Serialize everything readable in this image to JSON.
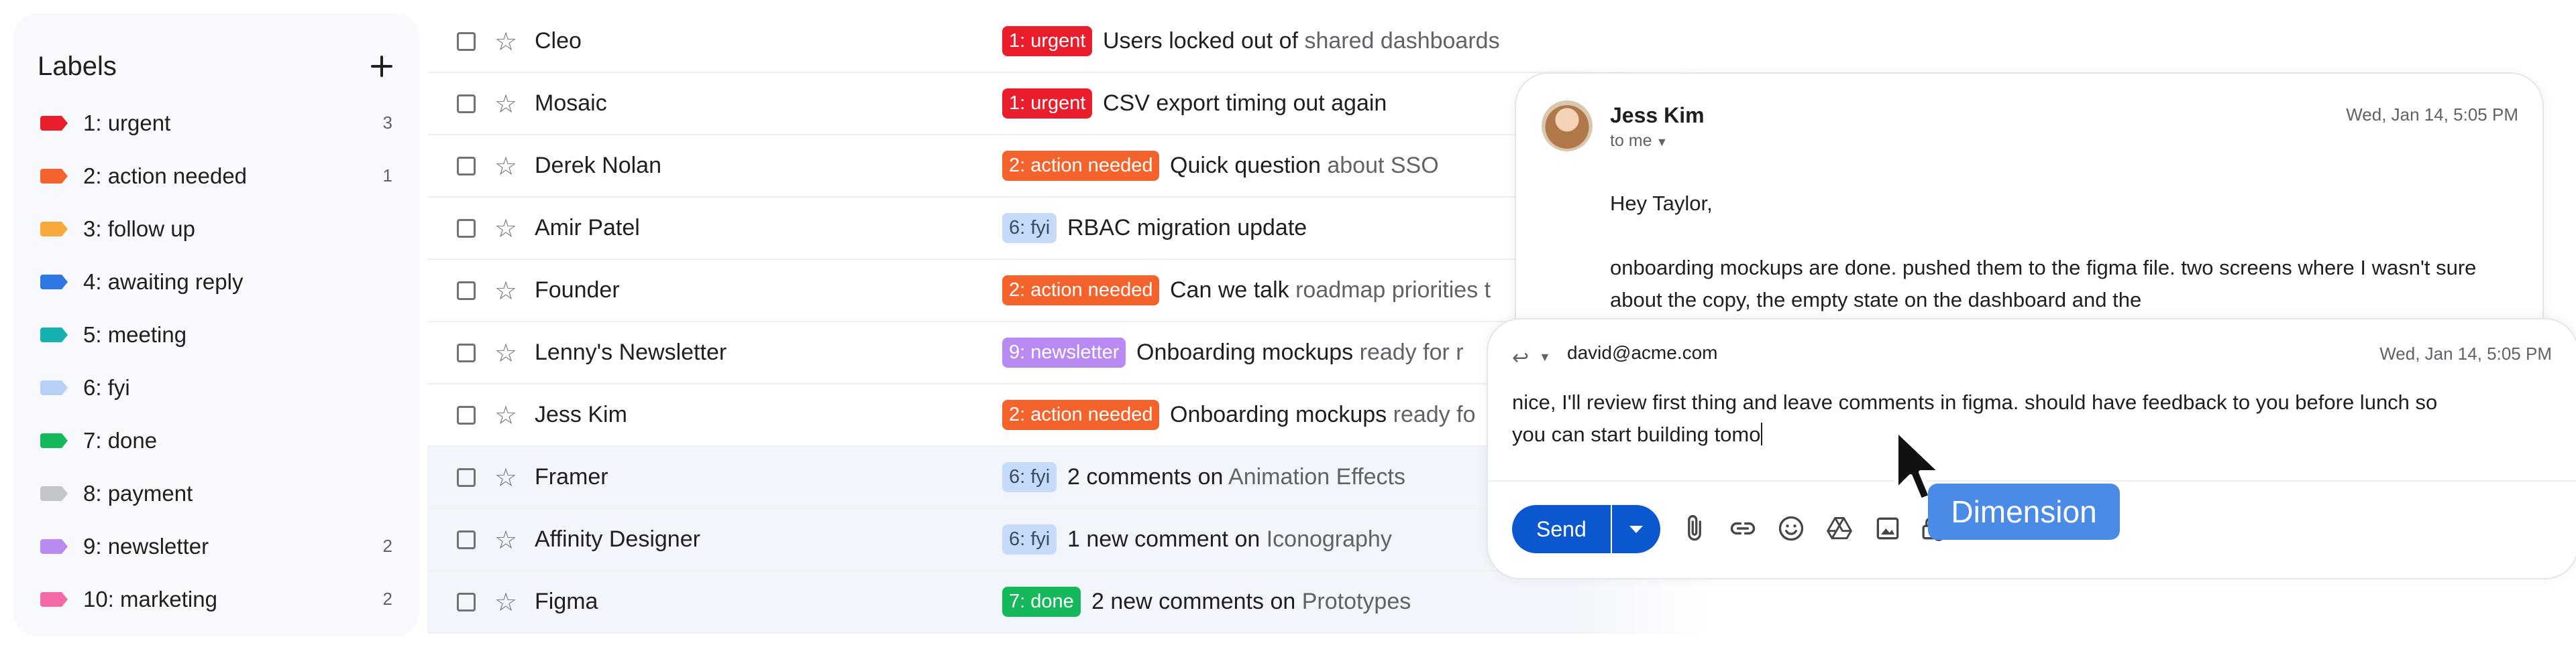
{
  "labels": {
    "title": "Labels",
    "items": [
      {
        "name": "1: urgent",
        "count": "3",
        "color": "#ea1d2c"
      },
      {
        "name": "2: action needed",
        "count": "1",
        "color": "#f4632b"
      },
      {
        "name": "3: follow up",
        "count": "",
        "color": "#f7a93b"
      },
      {
        "name": "4: awaiting reply",
        "count": "",
        "color": "#2f78e3"
      },
      {
        "name": "5: meeting",
        "count": "",
        "color": "#15b1b1"
      },
      {
        "name": "6: fyi",
        "count": "",
        "color": "#b7d0f7"
      },
      {
        "name": "7: done",
        "count": "",
        "color": "#16b85c"
      },
      {
        "name": "8: payment",
        "count": "",
        "color": "#c3c6ca"
      },
      {
        "name": "9: newsletter",
        "count": "2",
        "color": "#b98af2"
      },
      {
        "name": "10: marketing",
        "count": "2",
        "color": "#f46aa6"
      }
    ]
  },
  "messages": [
    {
      "sender": "Cleo",
      "label": "1: urgent",
      "label_bg": "#ea1d2c",
      "label_fg": "#ffffff",
      "subject": "Users locked out of",
      "snippet": " shared dashboards",
      "read": false
    },
    {
      "sender": "Mosaic",
      "label": "1: urgent",
      "label_bg": "#ea1d2c",
      "label_fg": "#ffffff",
      "subject": "CSV export timing out again",
      "snippet": "",
      "read": false
    },
    {
      "sender": "Derek Nolan",
      "label": "2: action needed",
      "label_bg": "#f4632b",
      "label_fg": "#ffffff",
      "subject": "Quick question",
      "snippet": " about SSO",
      "read": false
    },
    {
      "sender": "Amir Patel",
      "label": "6: fyi",
      "label_bg": "#c6dbfa",
      "label_fg": "#3b4a66",
      "subject": "RBAC migration update",
      "snippet": "",
      "read": false
    },
    {
      "sender": "Founder",
      "label": "2: action needed",
      "label_bg": "#f4632b",
      "label_fg": "#ffffff",
      "subject": "Can we talk",
      "snippet": " roadmap priorities t",
      "read": false
    },
    {
      "sender": "Lenny's Newsletter",
      "label": "9: newsletter",
      "label_bg": "#b98af2",
      "label_fg": "#ffffff",
      "subject": "Onboarding mockups",
      "snippet": " ready for r",
      "read": false
    },
    {
      "sender": "Jess Kim",
      "label": "2: action needed",
      "label_bg": "#f4632b",
      "label_fg": "#ffffff",
      "subject": "Onboarding mockups",
      "snippet": " ready fo",
      "read": false
    },
    {
      "sender": "Framer",
      "label": "6: fyi",
      "label_bg": "#c6dbfa",
      "label_fg": "#3b4a66",
      "subject": "2 comments on",
      "snippet": " Animation Effects",
      "read": true
    },
    {
      "sender": "Affinity Designer",
      "label": "6: fyi",
      "label_bg": "#c6dbfa",
      "label_fg": "#3b4a66",
      "subject": "1 new comment on",
      "snippet": " Iconography",
      "read": true
    },
    {
      "sender": "Figma",
      "label": "7: done",
      "label_bg": "#16b85c",
      "label_fg": "#ffffff",
      "subject": "2 new comments on",
      "snippet": " Prototypes",
      "read": true
    }
  ],
  "email": {
    "sender": "Jess Kim",
    "to": "to me",
    "date": "Wed, Jan 14, 5:05 PM",
    "greeting": "Hey Taylor,",
    "body": "onboarding mockups are done. pushed them to the figma file. two screens where I wasn't sure about the copy, the empty state on the dashboard and the"
  },
  "reply": {
    "to": "david@acme.com",
    "date": "Wed, Jan 14, 5:05 PM",
    "text": "nice, I'll review first thing and leave comments in figma. should have feedback to you before lunch so you can start building tomo",
    "send_label": "Send"
  },
  "tooltip": "Dimension"
}
